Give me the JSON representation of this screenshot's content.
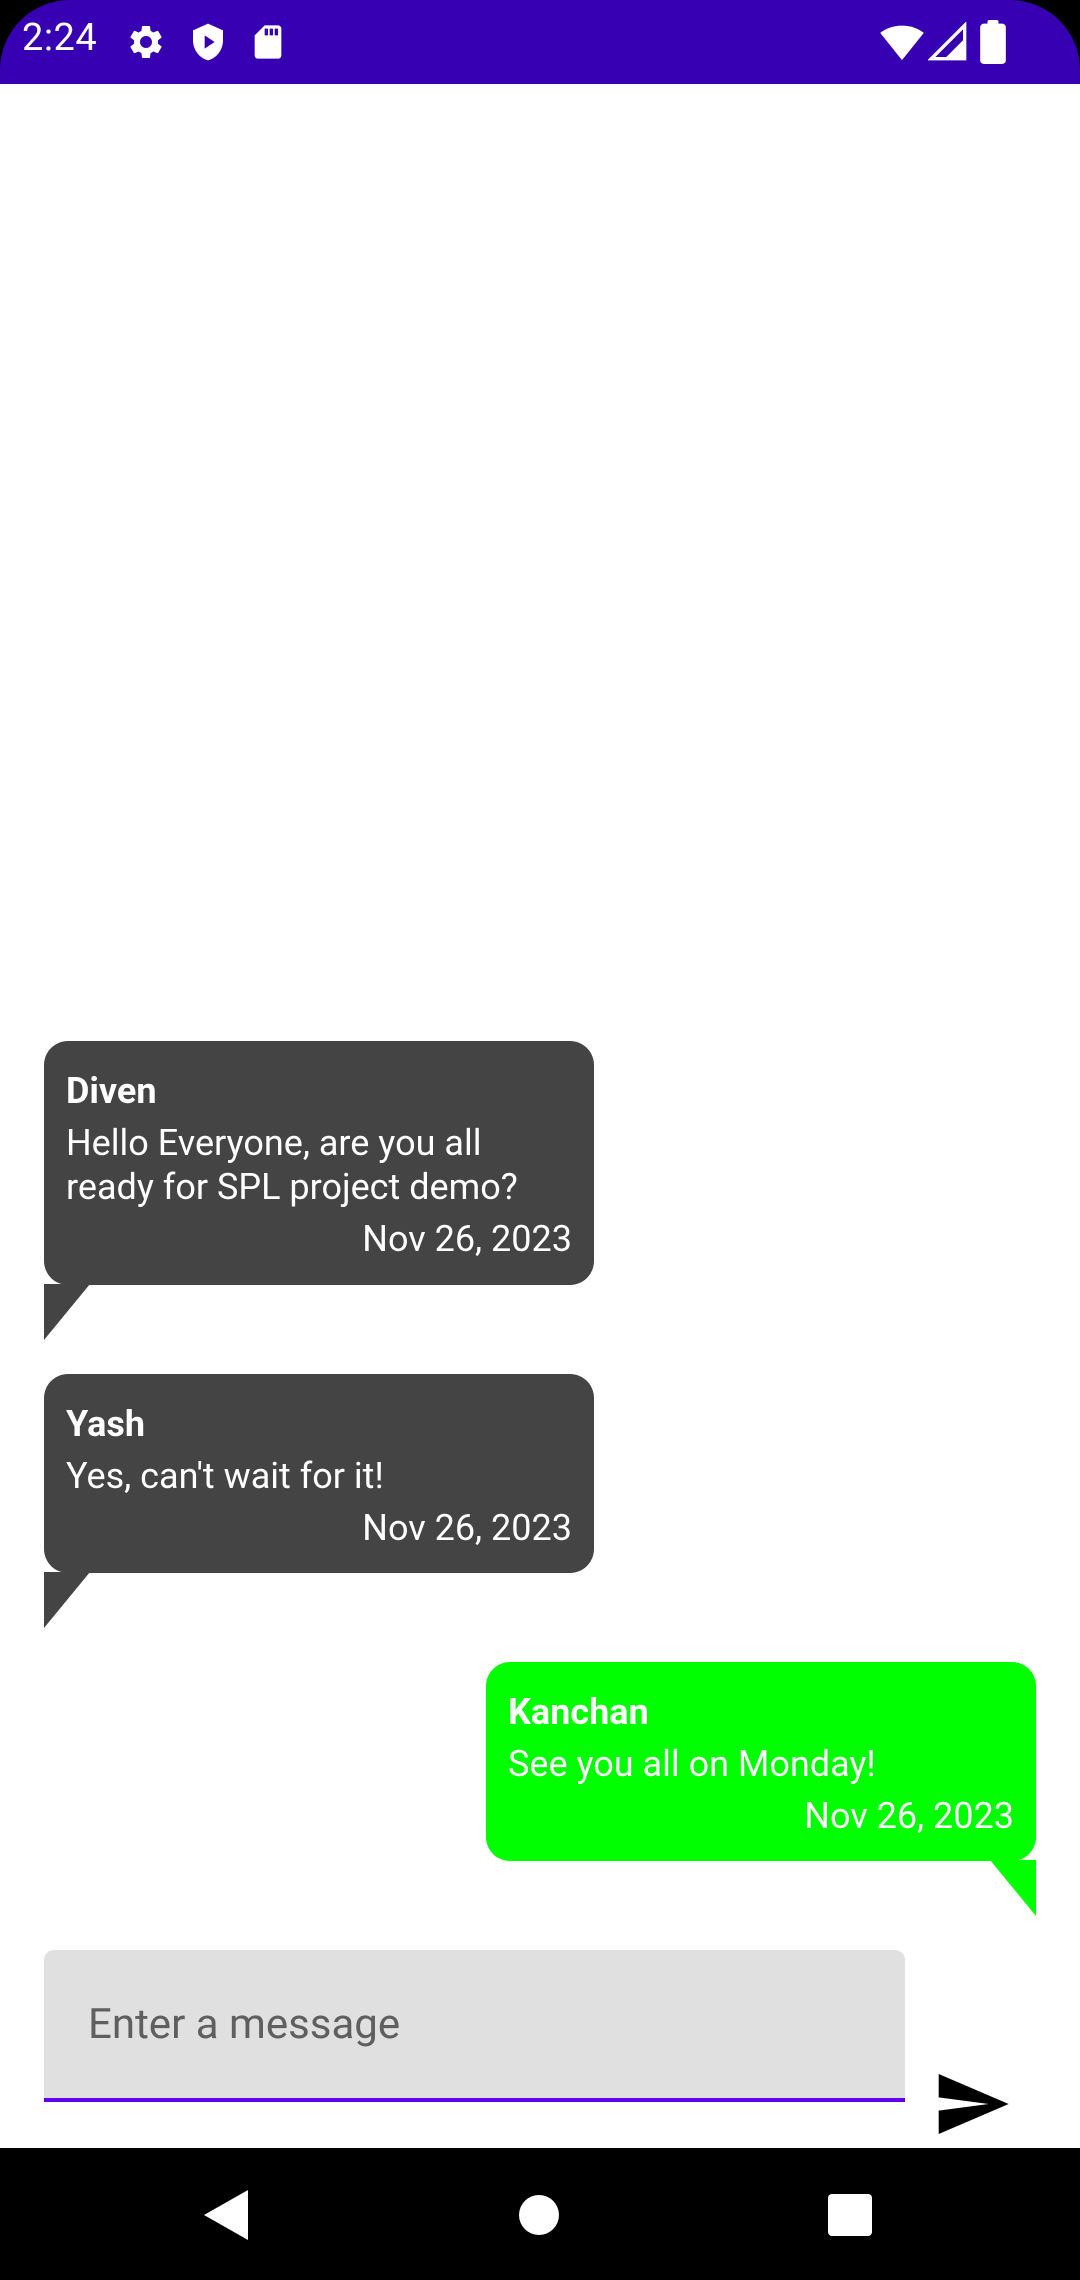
{
  "status_bar": {
    "time": "2:24",
    "background": "#3700B3",
    "left_icons": [
      "settings-icon",
      "shield-play-icon",
      "sd-card-icon"
    ],
    "right_icons": [
      "wifi-icon",
      "cell-signal-icon",
      "battery-icon"
    ]
  },
  "messages": [
    {
      "sender": "Diven",
      "text": "Hello Everyone, are you all ready for SPL project demo?",
      "date": "Nov 26, 2023",
      "direction": "received",
      "color": "#444444"
    },
    {
      "sender": "Yash",
      "text": "Yes, can't wait for it!",
      "date": "Nov 26, 2023",
      "direction": "received",
      "color": "#444444"
    },
    {
      "sender": "Kanchan",
      "text": "See you all on Monday!",
      "date": "Nov 26, 2023",
      "direction": "sent",
      "color": "#00FF00"
    }
  ],
  "composer": {
    "placeholder": "Enter a message",
    "value": "",
    "accent": "#6200EE",
    "send_icon": "send-icon"
  },
  "nav_bar": {
    "buttons": [
      "back-icon",
      "home-icon",
      "recents-icon"
    ]
  }
}
